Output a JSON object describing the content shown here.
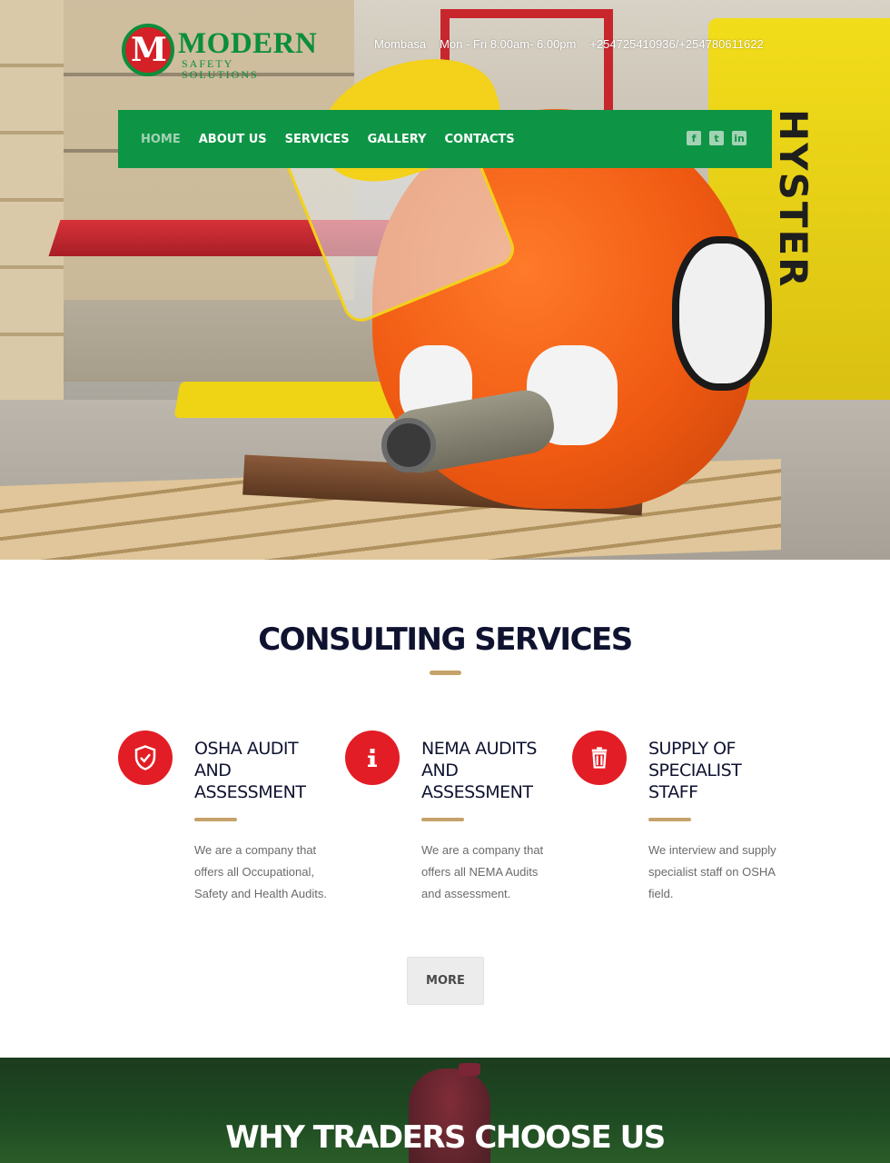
{
  "brand": {
    "logo_mark": "M",
    "name": "MODERN",
    "tagline": "SAFETY SOLUTIONS"
  },
  "topinfo": {
    "location": "Mombasa",
    "hours": "Mon - Fri 8.00am- 6.00pm",
    "phone": "+254725410936/+254780611622"
  },
  "nav": {
    "items": [
      {
        "label": "HOME",
        "active": true
      },
      {
        "label": "ABOUT US"
      },
      {
        "label": "SERVICES"
      },
      {
        "label": "GALLERY"
      },
      {
        "label": "CONTACTS"
      }
    ],
    "social": [
      "facebook-icon",
      "twitter-icon",
      "linkedin-icon"
    ]
  },
  "colors": {
    "green": "#0d9545",
    "red": "#e31d25",
    "gold": "#c6a26b",
    "navy": "#0f1330"
  },
  "consulting": {
    "title": "CONSULTING SERVICES",
    "services": [
      {
        "icon": "shield-check-icon",
        "title": "OSHA AUDIT AND ASSESSMENT",
        "text": "We are a company that offers all Occupational, Safety and Health Audits."
      },
      {
        "icon": "info-icon",
        "title": "NEMA AUDITS AND ASSESSMENT",
        "text": "We are a company that offers all NEMA Audits and assessment."
      },
      {
        "icon": "trash-icon",
        "title": "SUPPLY OF SPECIALIST STAFF",
        "text": "We interview and supply specialist staff on OSHA field."
      }
    ],
    "more_label": "MORE"
  },
  "why": {
    "title": "WHY TRADERS CHOOSE US"
  }
}
